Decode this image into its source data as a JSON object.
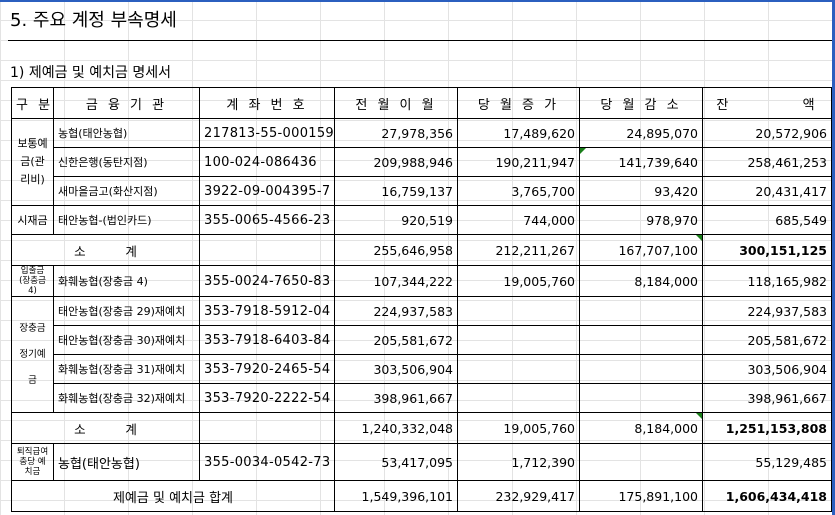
{
  "title": "5. 주요 계정 부속명세",
  "subtitle": "1) 제예금 및 예치금 명세서",
  "headers": [
    "구 분",
    "금 융 기 관",
    "계 좌 번 호",
    "전 월 이 월",
    "당 월 증 가",
    "당 월 감 소",
    "잔          액"
  ],
  "groups": {
    "g1": "보통예금(관리비)",
    "g2": "시재금",
    "g3": "입출금(장충금 4)",
    "g4a": "장충금",
    "g4b": "정기예금",
    "g5": "퇴직급여충당 예치금"
  },
  "rows": [
    {
      "bank": "농협(태안농협)",
      "acct": "217813-55-000159",
      "prev": "27,978,356",
      "inc": "17,489,620",
      "dec": "24,895,070",
      "bal": "20,572,906"
    },
    {
      "bank": "신한은행(동탄지점)",
      "acct": "100-024-086436",
      "prev": "209,988,946",
      "inc": "190,211,947",
      "dec": "141,739,640",
      "bal": "258,461,253"
    },
    {
      "bank": "새마을금고(화산지점)",
      "acct": "3922-09-004395-7",
      "prev": "16,759,137",
      "inc": "3,765,700",
      "dec": "93,420",
      "bal": "20,431,417"
    },
    {
      "bank": "태안농협-(법인카드)",
      "acct": "355-0065-4566-23",
      "prev": "920,519",
      "inc": "744,000",
      "dec": "978,970",
      "bal": "685,549"
    },
    {
      "bank": "화훼농협(장충금 4)",
      "acct": "355-0024-7650-83",
      "prev": "107,344,222",
      "inc": "19,005,760",
      "dec": "8,184,000",
      "bal": "118,165,982"
    },
    {
      "bank": "태안농협(장충금 29)재예치",
      "acct": "353-7918-5912-04",
      "prev": "224,937,583",
      "inc": "",
      "dec": "",
      "bal": "224,937,583"
    },
    {
      "bank": "태안농협(장충금 30)재예치",
      "acct": "353-7918-6403-84",
      "prev": "205,581,672",
      "inc": "",
      "dec": "",
      "bal": "205,581,672"
    },
    {
      "bank": "화훼농협(장충금 31)재예치",
      "acct": "353-7920-2465-54",
      "prev": "303,506,904",
      "inc": "",
      "dec": "",
      "bal": "303,506,904"
    },
    {
      "bank": "화훼농협(장충금 32)재예치",
      "acct": "353-7920-2222-54",
      "prev": "398,961,667",
      "inc": "",
      "dec": "",
      "bal": "398,961,667"
    },
    {
      "bank": "농협(태안농협)",
      "acct": "355-0034-0542-73",
      "prev": "53,417,095",
      "inc": "1,712,390",
      "dec": "",
      "bal": "55,129,485"
    }
  ],
  "subtotal1": {
    "label": "소          계",
    "prev": "255,646,958",
    "inc": "212,211,267",
    "dec": "167,707,100",
    "bal": "300,151,125"
  },
  "subtotal2": {
    "label": "소          계",
    "prev": "1,240,332,048",
    "inc": "19,005,760",
    "dec": "8,184,000",
    "bal": "1,251,153,808"
  },
  "total": {
    "label": "제예금 및 예치금 합계",
    "prev": "1,549,396,101",
    "inc": "232,929,417",
    "dec": "175,891,100",
    "bal": "1,606,434,418"
  },
  "colors": {
    "accent": "#2b5fbf",
    "comment_marker": "#1a7f1a"
  }
}
